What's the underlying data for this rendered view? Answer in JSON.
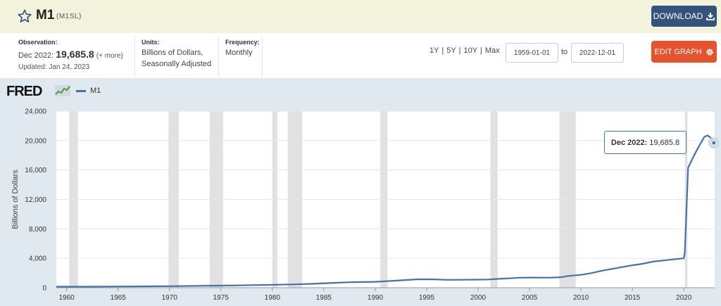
{
  "header": {
    "title": "M1",
    "series_id": "(M1SL)",
    "download_label": "DOWNLOAD"
  },
  "meta": {
    "observation_label": "Observation:",
    "observation_date": "Dec 2022:",
    "observation_value": "19,685.8",
    "observation_more": "(+ more)",
    "updated": "Updated: Jan 24, 2023",
    "units_label": "Units:",
    "units_line1": "Billions of Dollars,",
    "units_line2": "Seasonally Adjusted",
    "frequency_label": "Frequency:",
    "frequency_value": "Monthly"
  },
  "controls": {
    "ranges": [
      "1Y",
      "5Y",
      "10Y",
      "Max"
    ],
    "start_date": "1959-01-01",
    "to_label": "to",
    "end_date": "2022-12-01",
    "edit_label": "EDIT GRAPH"
  },
  "logo": "FRED",
  "tooltip": {
    "date": "Dec 2022:",
    "value": "19,685.8"
  },
  "chart_data": {
    "type": "line",
    "series": [
      {
        "name": "M1",
        "color": "#4572a7",
        "points": [
          [
            1959.0,
            139
          ],
          [
            1960.0,
            141
          ],
          [
            1962.0,
            147
          ],
          [
            1964.0,
            160
          ],
          [
            1966.0,
            172
          ],
          [
            1968.0,
            190
          ],
          [
            1970.0,
            210
          ],
          [
            1972.0,
            240
          ],
          [
            1974.0,
            275
          ],
          [
            1976.0,
            300
          ],
          [
            1978.0,
            350
          ],
          [
            1980.0,
            390
          ],
          [
            1982.0,
            450
          ],
          [
            1984.0,
            540
          ],
          [
            1986.0,
            660
          ],
          [
            1987.5,
            750
          ],
          [
            1990.0,
            800
          ],
          [
            1992.0,
            960
          ],
          [
            1994.0,
            1140
          ],
          [
            1995.5,
            1150
          ],
          [
            1997.0,
            1075
          ],
          [
            1998.5,
            1080
          ],
          [
            2000.0,
            1100
          ],
          [
            2001.0,
            1120
          ],
          [
            2002.0,
            1200
          ],
          [
            2003.0,
            1270
          ],
          [
            2004.0,
            1360
          ],
          [
            2005.0,
            1380
          ],
          [
            2006.0,
            1370
          ],
          [
            2007.0,
            1370
          ],
          [
            2008.0,
            1420
          ],
          [
            2008.8,
            1600
          ],
          [
            2010.0,
            1750
          ],
          [
            2011.0,
            1980
          ],
          [
            2012.0,
            2300
          ],
          [
            2013.0,
            2550
          ],
          [
            2014.0,
            2800
          ],
          [
            2015.0,
            3050
          ],
          [
            2016.0,
            3250
          ],
          [
            2017.0,
            3550
          ],
          [
            2018.0,
            3700
          ],
          [
            2019.0,
            3850
          ],
          [
            2020.0,
            4000
          ],
          [
            2020.1,
            4800
          ],
          [
            2020.42,
            16300
          ],
          [
            2021.0,
            18000
          ],
          [
            2021.5,
            19300
          ],
          [
            2022.0,
            20500
          ],
          [
            2022.3,
            20700
          ],
          [
            2022.6,
            20400
          ],
          [
            2022.92,
            19685.8
          ]
        ]
      }
    ],
    "recessions": [
      [
        1960.25,
        1961.1
      ],
      [
        1969.9,
        1970.9
      ],
      [
        1973.9,
        1975.2
      ],
      [
        1980.0,
        1980.5
      ],
      [
        1981.5,
        1982.9
      ],
      [
        1990.5,
        1991.2
      ],
      [
        2001.2,
        2001.9
      ],
      [
        2007.9,
        2009.5
      ],
      [
        2020.1,
        2020.35
      ]
    ],
    "x_ticks": [
      "1960",
      "1965",
      "1970",
      "1975",
      "1980",
      "1985",
      "1990",
      "1995",
      "2000",
      "2005",
      "2010",
      "2015",
      "2020"
    ],
    "y_ticks": [
      "0",
      "4,000",
      "8,000",
      "12,000",
      "16,000",
      "20,000",
      "24,000"
    ],
    "xlim": [
      1959,
      2023
    ],
    "ylim": [
      0,
      24000
    ],
    "ylabel": "Billions of Dollars",
    "legend": "M1",
    "grid": true
  }
}
